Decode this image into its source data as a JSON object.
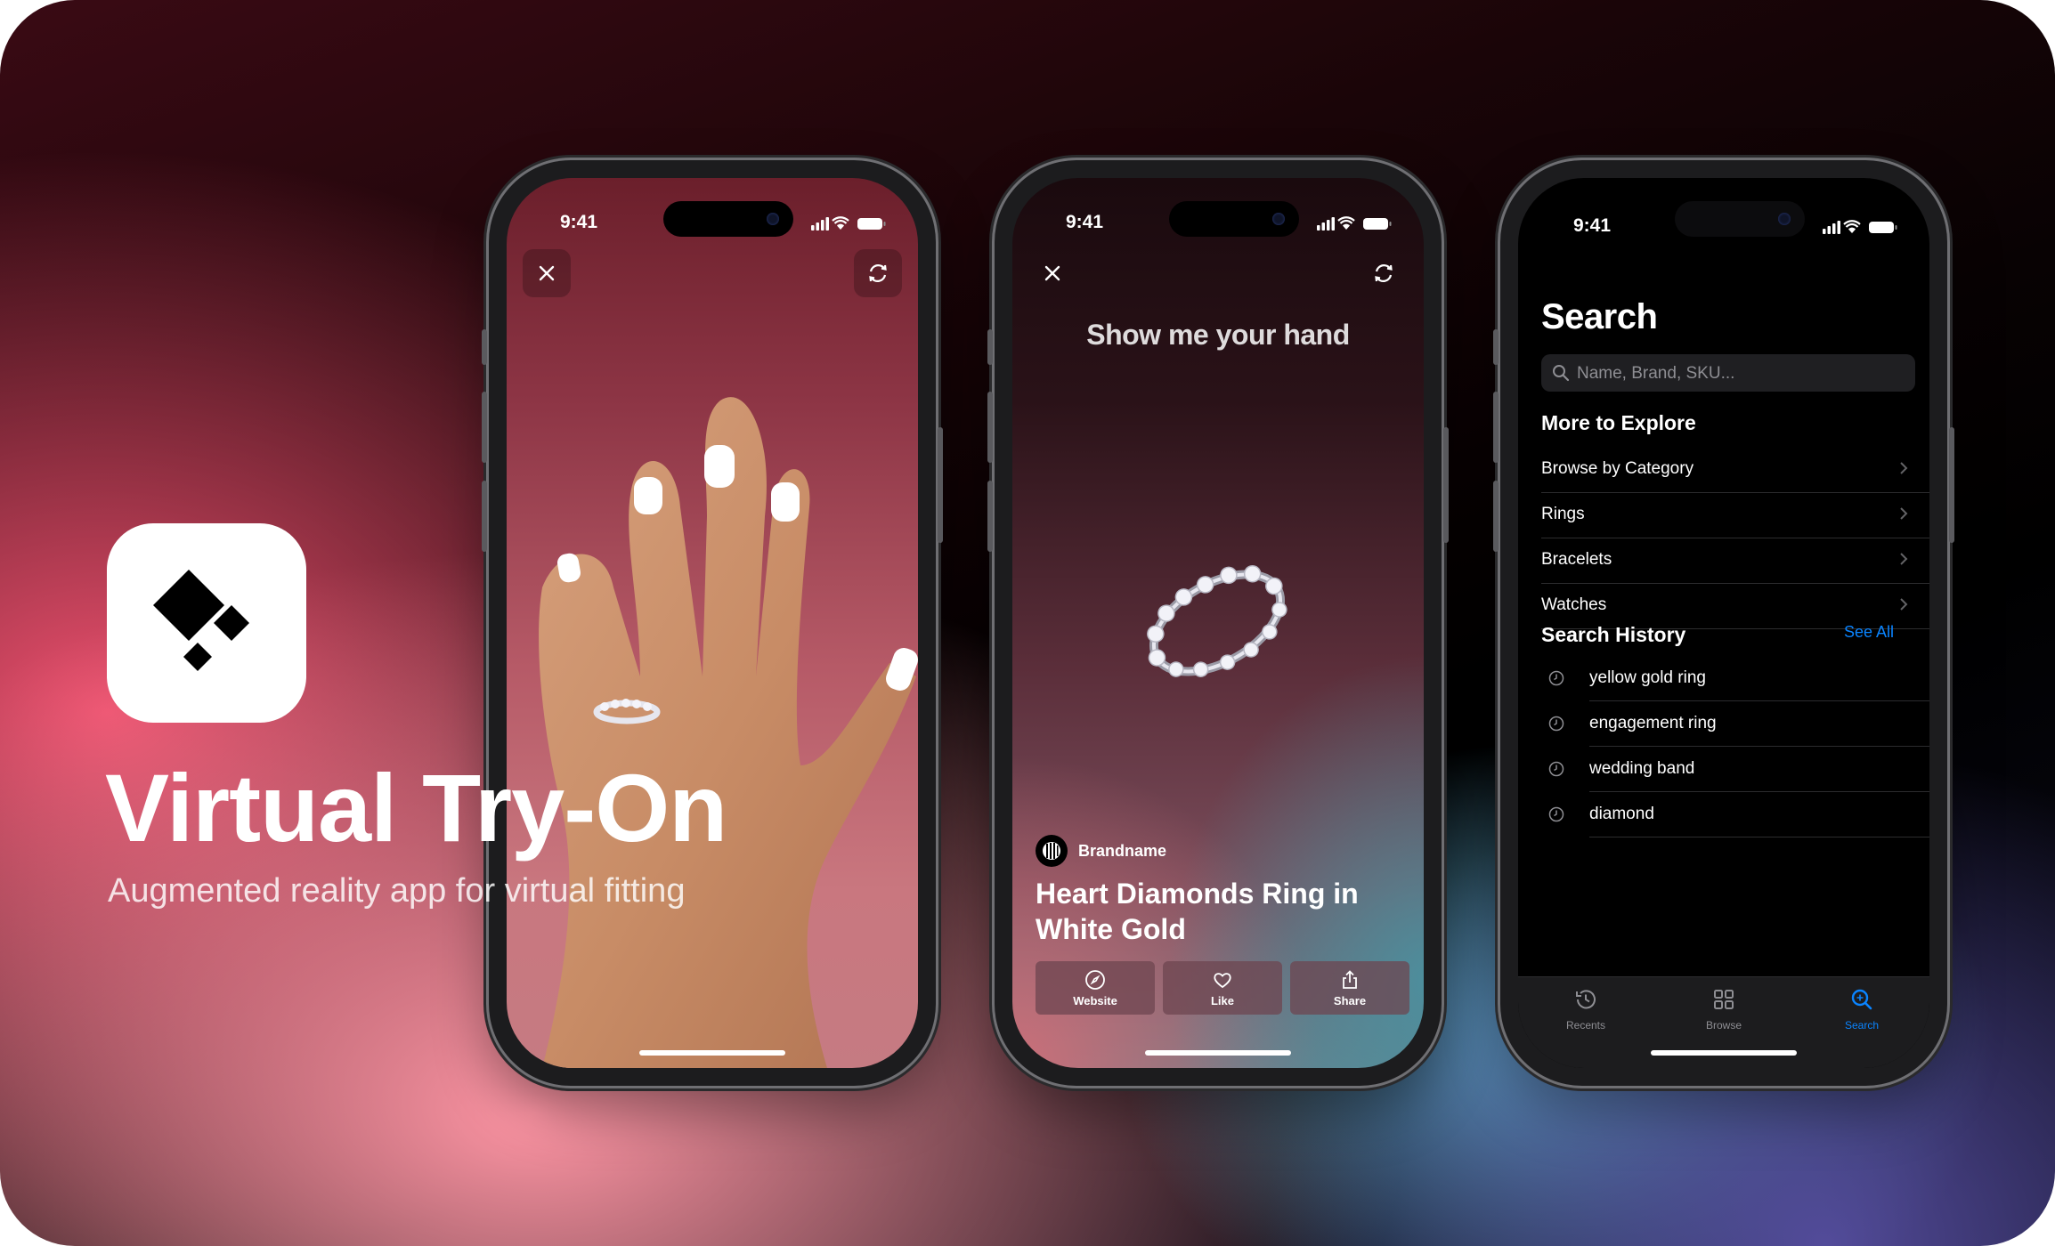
{
  "hero": {
    "title": "Virtual Try-On",
    "subtitle": "Augmented reality app for virtual fitting",
    "icon": "diamond-logo-icon"
  },
  "status_bar": {
    "time": "9:41"
  },
  "screen1": {
    "close_icon": "close-icon",
    "flip_icon": "camera-flip-icon"
  },
  "screen2": {
    "prompt": "Show me your hand",
    "brand": "Brandname",
    "product_title": "Heart Diamonds Ring in White Gold",
    "actions": [
      {
        "label": "Website",
        "icon": "compass-icon"
      },
      {
        "label": "Like",
        "icon": "heart-icon"
      },
      {
        "label": "Share",
        "icon": "share-icon"
      }
    ]
  },
  "screen3": {
    "title": "Search",
    "search_placeholder": "Name, Brand, SKU...",
    "explore_heading": "More to Explore",
    "explore_items": [
      "Browse by Category",
      "Rings",
      "Bracelets",
      "Watches"
    ],
    "history_heading": "Search History",
    "see_all": "See All",
    "history_items": [
      "yellow gold ring",
      "engagement ring",
      "wedding band",
      "diamond"
    ],
    "tabs": [
      {
        "label": "Recents",
        "icon": "clock-icon",
        "active": false
      },
      {
        "label": "Browse",
        "icon": "grid-icon",
        "active": false
      },
      {
        "label": "Search",
        "icon": "search-icon",
        "active": true
      }
    ]
  },
  "colors": {
    "accent_blue": "#0a84ff",
    "tab_inactive": "#8e8e93",
    "hero_pink": "#ec506e"
  }
}
